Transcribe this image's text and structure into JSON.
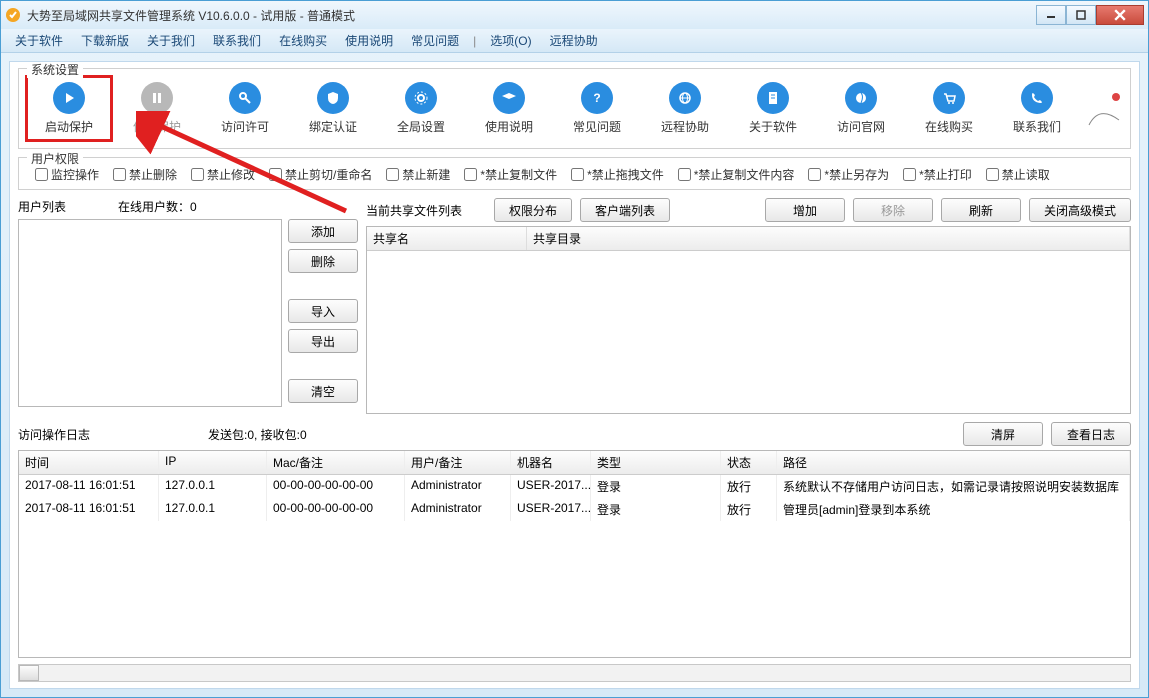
{
  "window": {
    "title": "大势至局域网共享文件管理系统 V10.6.0.0 - 试用版 - 普通模式"
  },
  "menu": {
    "about_software": "关于软件",
    "download_new": "下载新版",
    "about_us": "关于我们",
    "contact_us": "联系我们",
    "buy_online": "在线购买",
    "usage_guide": "使用说明",
    "faq": "常见问题",
    "options": "选项(O)",
    "remote_help": "远程协助"
  },
  "toolbar": {
    "section_title": "系统设置",
    "start_protect": "启动保护",
    "stop_protect": "停止保护",
    "access_permit": "访问许可",
    "bind_auth": "绑定认证",
    "global_settings": "全局设置",
    "usage_guide": "使用说明",
    "faq": "常见问题",
    "remote_help": "远程协助",
    "about_software": "关于软件",
    "visit_website": "访问官网",
    "buy_online": "在线购买",
    "contact_us": "联系我们"
  },
  "permissions": {
    "section_title": "用户权限",
    "monitor_ops": "监控操作",
    "forbid_delete": "禁止删除",
    "forbid_modify": "禁止修改",
    "forbid_cut_rename": "禁止剪切/重命名",
    "forbid_new": "禁止新建",
    "forbid_copy_file": "*禁止复制文件",
    "forbid_drag_file": "*禁止拖拽文件",
    "forbid_copy_content": "*禁止复制文件内容",
    "forbid_save_as": "*禁止另存为",
    "forbid_print": "*禁止打印",
    "forbid_read": "禁止读取"
  },
  "user_list": {
    "label": "用户列表",
    "online_label": "在线用户数：",
    "online_count": "0",
    "btn_add": "添加",
    "btn_delete": "删除",
    "btn_import": "导入",
    "btn_export": "导出",
    "btn_clear": "清空"
  },
  "share_list": {
    "label": "当前共享文件列表",
    "btn_perm_dist": "权限分布",
    "btn_client_list": "客户端列表",
    "btn_add": "增加",
    "btn_remove": "移除",
    "btn_refresh": "刷新",
    "btn_close_adv": "关闭高级模式",
    "col_share_name": "共享名",
    "col_share_dir": "共享目录"
  },
  "log": {
    "label": "访问操作日志",
    "packet_info": "发送包:0, 接收包:0",
    "btn_clear_screen": "清屏",
    "btn_view_log": "查看日志",
    "cols": {
      "time": "时间",
      "ip": "IP",
      "mac": "Mac/备注",
      "user": "用户/备注",
      "machine": "机器名",
      "type": "类型",
      "status": "状态",
      "path": "路径"
    },
    "rows": [
      {
        "time": "2017-08-11 16:01:51",
        "ip": "127.0.0.1",
        "mac": "00-00-00-00-00-00",
        "user": "Administrator",
        "machine": "USER-2017...",
        "type": "登录",
        "status": "放行",
        "path": "系统默认不存储用户访问日志，如需记录请按照说明安装数据库"
      },
      {
        "time": "2017-08-11 16:01:51",
        "ip": "127.0.0.1",
        "mac": "00-00-00-00-00-00",
        "user": "Administrator",
        "machine": "USER-2017...",
        "type": "登录",
        "status": "放行",
        "path": "管理员[admin]登录到本系统"
      }
    ]
  },
  "colors": {
    "toolbar_icon_blue": "#2a8de0",
    "toolbar_icon_gray": "#b8b8b8",
    "highlight_red": "#e02020"
  }
}
